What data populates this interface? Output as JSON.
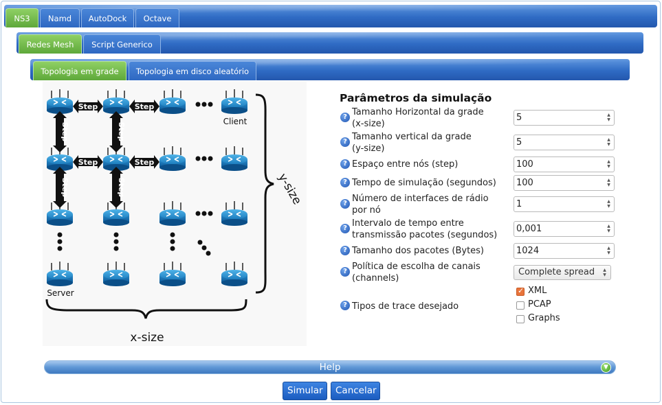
{
  "top_tabs": [
    {
      "label": "NS3",
      "active": true
    },
    {
      "label": "Namd",
      "active": false
    },
    {
      "label": "AutoDock",
      "active": false
    },
    {
      "label": "Octave",
      "active": false
    }
  ],
  "second_tabs": [
    {
      "label": "Redes Mesh",
      "active": true
    },
    {
      "label": "Script Generico",
      "active": false
    }
  ],
  "third_tabs": [
    {
      "label": "Topologia em grade",
      "active": true
    },
    {
      "label": "Topologia em disco aleatório",
      "active": false
    }
  ],
  "diagram": {
    "step_label": "Step",
    "client_label": "Client",
    "server_label": "Server",
    "ysize_label": "y-size",
    "xsize_label": "x-size"
  },
  "params": {
    "title": "Parâmetros da simulação",
    "fields": [
      {
        "label_line1": "Tamanho Horizontal da grade",
        "label_line2": "(x-size)",
        "value": "5"
      },
      {
        "label_line1": "Tamanho vertical da grade",
        "label_line2": "(y-size)",
        "value": "5"
      },
      {
        "label_line1": "Espaço entre nós (step)",
        "label_line2": "",
        "value": "100"
      },
      {
        "label_line1": "Tempo de simulação (segundos)",
        "label_line2": "",
        "value": "100"
      },
      {
        "label_line1": "Número de interfaces de rádio",
        "label_line2": "por nó",
        "value": "1"
      },
      {
        "label_line1": "Intervalo de tempo entre",
        "label_line2": "transmissão pacotes (segundos)",
        "value": "0,001"
      },
      {
        "label_line1": "Tamanho dos pacotes (Bytes)",
        "label_line2": "",
        "value": "1024"
      }
    ],
    "channel_label_line1": "Política de escolha de canais",
    "channel_label_line2": "(channels)",
    "channel_value": "Complete spread",
    "trace_label": "Tipos de trace desejado",
    "trace_options": [
      {
        "label": "XML",
        "checked": true
      },
      {
        "label": "PCAP",
        "checked": false
      },
      {
        "label": "Graphs",
        "checked": false
      }
    ]
  },
  "help_label": "Help",
  "buttons": {
    "submit": "Simular",
    "cancel": "Cancelar"
  },
  "colors": {
    "tab_active": "#6db546",
    "tab_bar": "#2f6bc4",
    "button": "#1f60c4",
    "checkbox_on": "#e8743b"
  }
}
